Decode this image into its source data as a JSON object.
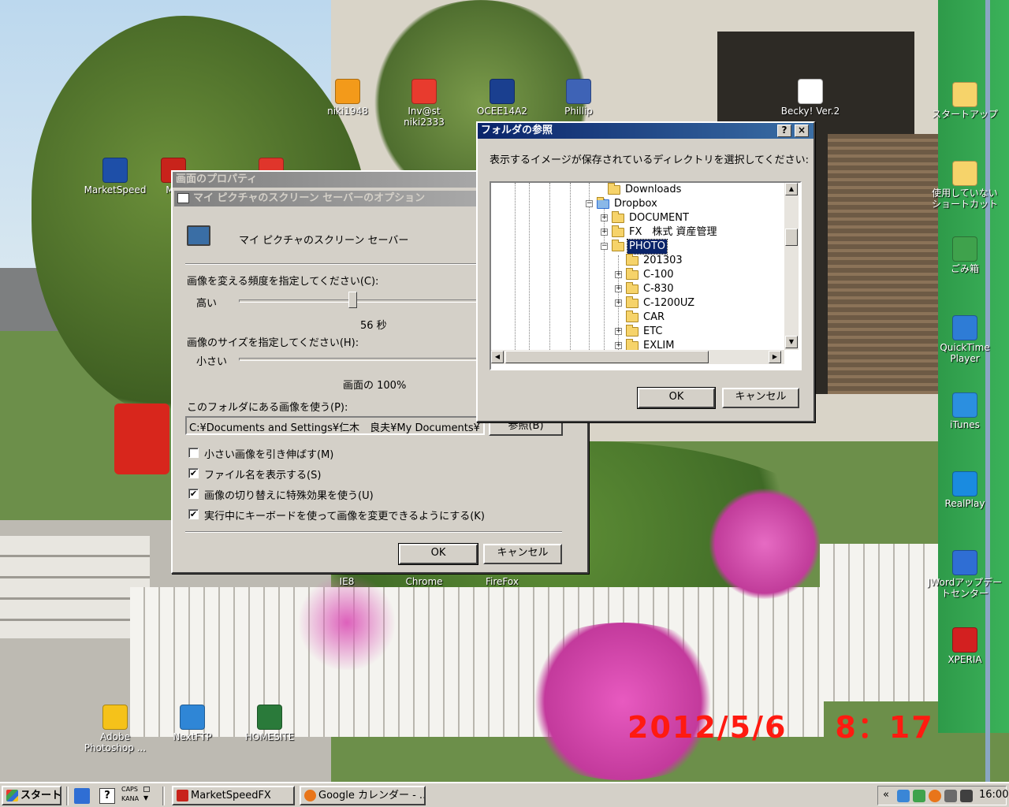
{
  "photo_date": "2012/5/6    8：17",
  "desktop_icons": [
    {
      "label": "niki1948",
      "color": "#f39a1a"
    },
    {
      "label": "Inv@st\nniki2333",
      "color": "#e83b2e"
    },
    {
      "label": "OCEE14A2",
      "color": "#1a3f8f"
    },
    {
      "label": "Phillip",
      "color": "#3e63b6"
    },
    {
      "label": "Becky! Ver.2",
      "color": "#ffffff"
    },
    {
      "label": "スタートアップ",
      "color": "#f6d36a"
    },
    {
      "label": "MarketSpeed",
      "color": "#1e4fa8"
    },
    {
      "label": "Ma",
      "color": "#c8231b"
    },
    {
      "label": "",
      "color": "#e0352b"
    },
    {
      "label": "使用していない\nショートカット",
      "color": "#f6d36a"
    },
    {
      "label": "ごみ箱",
      "color": "#3fa24c"
    },
    {
      "label": "QuickTime\nPlayer",
      "color": "#2e7cd6"
    },
    {
      "label": "iTunes",
      "color": "#2b8fe0"
    },
    {
      "label": "RealPlay",
      "color": "#1a8be0"
    },
    {
      "label": "JWordアップデー\nトセンター",
      "color": "#2f6ed4"
    },
    {
      "label": "XPERIA",
      "color": "#d32020"
    },
    {
      "label": "IE8",
      "color": "#2f6ed4"
    },
    {
      "label": "Chrome",
      "color": "#3aa34a"
    },
    {
      "label": "FireFox",
      "color": "#e8751a"
    },
    {
      "label": "Adobe\nPhotoshop ...",
      "color": "#f5c21a"
    },
    {
      "label": "NextFTP",
      "color": "#2f86d6"
    },
    {
      "label": "HOMESITE",
      "color": "#2a7a3a"
    }
  ],
  "display_props": {
    "outer_title": "画面のプロパティ",
    "title": "マイ ピクチャのスクリーン セーバーのオプション",
    "header_text": "マイ ピクチャのスクリーン セーバー",
    "freq_label": "画像を変える頻度を指定してください(C):",
    "freq_high": "高い",
    "freq_value": "56 秒",
    "freq_level": 0.34,
    "size_label": "画像のサイズを指定してください(H):",
    "size_small": "小さい",
    "size_value": "画面の 100%",
    "size_level": 1.0,
    "folder_label": "このフォルダにある画像を使う(P):",
    "folder_path": "C:¥Documents and Settings¥仁木　良夫¥My Documents¥",
    "browse_label": "参照(B)",
    "options": [
      {
        "label": "小さい画像を引き伸ばす(M)",
        "checked": false
      },
      {
        "label": "ファイル名を表示する(S)",
        "checked": true
      },
      {
        "label": "画像の切り替えに特殊効果を使う(U)",
        "checked": true
      },
      {
        "label": "実行中にキーボードを使って画像を変更できるようにする(K)",
        "checked": true
      }
    ],
    "ok_label": "OK",
    "cancel_label": "キャンセル"
  },
  "folder_dialog": {
    "title": "フォルダの参照",
    "help_button": "?",
    "close_button": "×",
    "prompt": "表示するイメージが保存されているディレクトリを選択してください:",
    "tree": [
      {
        "label": "Downloads",
        "level": 0,
        "expander": "",
        "selected": false
      },
      {
        "label": "Dropbox",
        "level": -1,
        "expander": "−",
        "selected": false
      },
      {
        "label": "DOCUMENT",
        "level": 1,
        "expander": "+",
        "selected": false
      },
      {
        "label": "FX　株式 資産管理",
        "level": 1,
        "expander": "+",
        "selected": false
      },
      {
        "label": "PHOTO",
        "level": 1,
        "expander": "−",
        "selected": true
      },
      {
        "label": "201303",
        "level": 2,
        "expander": "",
        "selected": false
      },
      {
        "label": "C-100",
        "level": 2,
        "expander": "+",
        "selected": false
      },
      {
        "label": "C-830",
        "level": 2,
        "expander": "+",
        "selected": false
      },
      {
        "label": "C-1200UZ",
        "level": 2,
        "expander": "+",
        "selected": false
      },
      {
        "label": "CAR",
        "level": 2,
        "expander": "",
        "selected": false
      },
      {
        "label": "ETC",
        "level": 2,
        "expander": "+",
        "selected": false
      },
      {
        "label": "EXLIM",
        "level": 2,
        "expander": "+",
        "selected": false
      }
    ],
    "ok_label": "OK",
    "cancel_label": "キャンセル"
  },
  "taskbar": {
    "start_label": "スタート",
    "caps_label": "CAPS",
    "kana_label": "KANA",
    "tasks": [
      {
        "label": "MarketSpeedFX",
        "color": "#c8231b"
      },
      {
        "label": "Google カレンダー - ...",
        "color": "#e8751a"
      }
    ],
    "tray_chevron": "«",
    "clock": "16:00"
  }
}
